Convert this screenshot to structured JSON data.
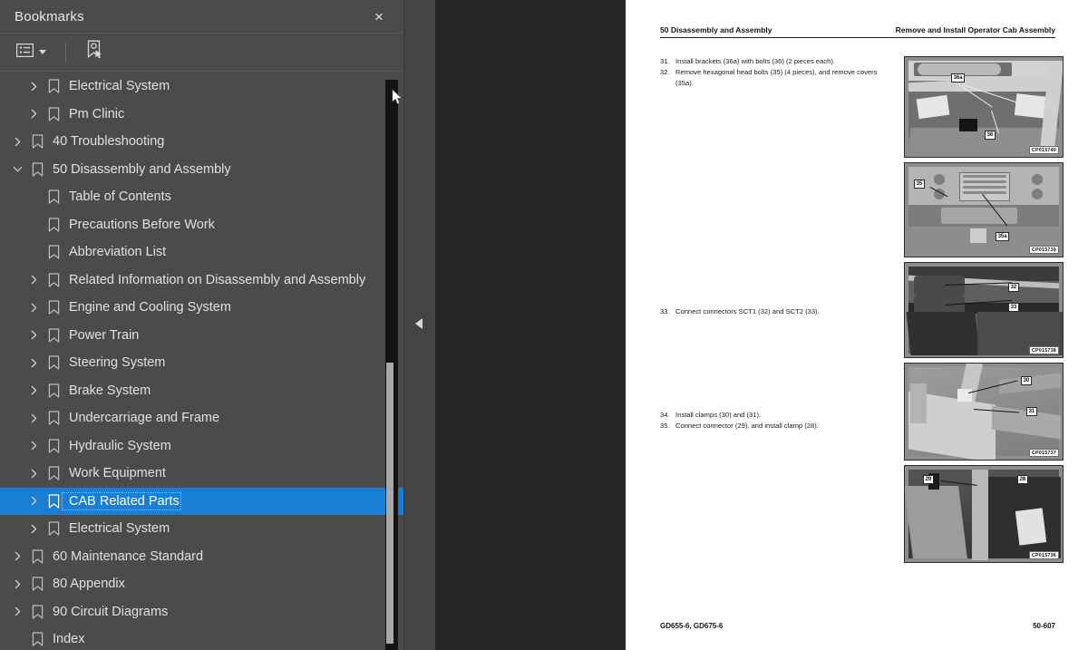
{
  "panel": {
    "title": "Bookmarks",
    "close_label": "×",
    "toolbar": {
      "options_icon": "list-options-icon",
      "find_bookmark_icon": "bookmark-find-icon"
    }
  },
  "tree": {
    "items": [
      {
        "label": "Electrical System",
        "depth": 1,
        "state": "collapsed",
        "selected": false
      },
      {
        "label": "Pm Clinic",
        "depth": 1,
        "state": "collapsed",
        "selected": false
      },
      {
        "label": "40 Troubleshooting",
        "depth": 0,
        "state": "collapsed",
        "selected": false
      },
      {
        "label": "50 Disassembly and Assembly",
        "depth": 0,
        "state": "expanded",
        "selected": false
      },
      {
        "label": "Table of Contents",
        "depth": 1,
        "state": "leaf",
        "selected": false
      },
      {
        "label": "Precautions Before Work",
        "depth": 1,
        "state": "leaf",
        "selected": false
      },
      {
        "label": "Abbreviation List",
        "depth": 1,
        "state": "leaf",
        "selected": false
      },
      {
        "label": "Related Information on Disassembly and Assembly",
        "depth": 1,
        "state": "collapsed",
        "selected": false
      },
      {
        "label": "Engine and Cooling System",
        "depth": 1,
        "state": "collapsed",
        "selected": false
      },
      {
        "label": "Power Train",
        "depth": 1,
        "state": "collapsed",
        "selected": false
      },
      {
        "label": "Steering System",
        "depth": 1,
        "state": "collapsed",
        "selected": false
      },
      {
        "label": "Brake System",
        "depth": 1,
        "state": "collapsed",
        "selected": false
      },
      {
        "label": "Undercarriage and Frame",
        "depth": 1,
        "state": "collapsed",
        "selected": false
      },
      {
        "label": "Hydraulic System",
        "depth": 1,
        "state": "collapsed",
        "selected": false
      },
      {
        "label": "Work Equipment",
        "depth": 1,
        "state": "collapsed",
        "selected": false
      },
      {
        "label": "CAB Related Parts",
        "depth": 1,
        "state": "collapsed",
        "selected": true
      },
      {
        "label": "Electrical System",
        "depth": 1,
        "state": "collapsed",
        "selected": false
      },
      {
        "label": "60 Maintenance Standard",
        "depth": 0,
        "state": "collapsed",
        "selected": false
      },
      {
        "label": "80 Appendix",
        "depth": 0,
        "state": "collapsed",
        "selected": false
      },
      {
        "label": "90 Circuit Diagrams",
        "depth": 0,
        "state": "collapsed",
        "selected": false
      },
      {
        "label": "Index",
        "depth": 0,
        "state": "leaf",
        "selected": false
      }
    ],
    "selection_color": "#1a7fd4"
  },
  "viewer": {
    "collapse_handle_icon": "collapse-left-icon"
  },
  "document": {
    "header_left": "50 Disassembly and Assembly",
    "header_right": "Remove and Install Operator Cab Assembly",
    "footer_left": "GD655-6, GD675-6",
    "footer_right": "50-607",
    "steps": [
      {
        "num": "31.",
        "text": "Install brackets (36a) with bolts (36) (2 pieces each)."
      },
      {
        "num": "32.",
        "text": "Remove hexagonal head bolts (35) (4 pieces), and remove covers (35a)."
      },
      {
        "num": "33.",
        "text": "Connect connectors SCT1 (32) and SCT2 (33)."
      },
      {
        "num": "34.",
        "text": "Install clamps (30) and (31)."
      },
      {
        "num": "35.",
        "text": "Connect connector (29), and install clamp (28)."
      }
    ],
    "figures": [
      {
        "caption": "CP015740",
        "callouts": [
          "36a",
          "36"
        ]
      },
      {
        "caption": "CP015739",
        "callouts": [
          "35",
          "35a"
        ]
      },
      {
        "caption": "CP015738",
        "callouts": [
          "32",
          "33"
        ]
      },
      {
        "caption": "CP015737",
        "callouts": [
          "30",
          "31"
        ]
      },
      {
        "caption": "CP015736",
        "callouts": [
          "29",
          "28"
        ]
      }
    ]
  }
}
